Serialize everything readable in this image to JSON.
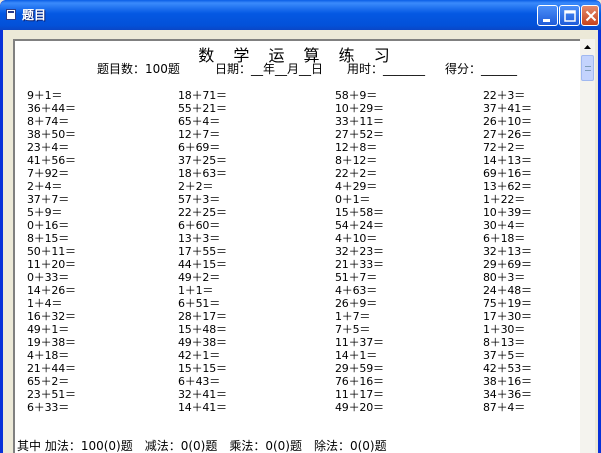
{
  "window": {
    "title": "题目"
  },
  "paper": {
    "heading": "数 学 运 算 练 习",
    "count_label": "题目数：100题",
    "date_label": "日期：__年__月__日",
    "time_label": "用时：_______",
    "score_label": "得分：______"
  },
  "problems": {
    "col1": [
      "9＋1＝",
      "36＋44＝",
      "8＋74＝",
      "38＋50＝",
      "23＋4＝",
      "41＋56＝",
      "7＋92＝",
      "2＋4＝",
      "37＋7＝",
      "5＋9＝",
      "0＋16＝",
      "8＋15＝",
      "50＋11＝",
      "11＋20＝",
      "0＋33＝",
      "14＋26＝",
      "1＋4＝",
      "16＋32＝",
      "49＋1＝",
      "19＋38＝",
      "4＋18＝",
      "21＋44＝",
      "65＋2＝",
      "23＋51＝",
      "6＋33＝"
    ],
    "col2": [
      "18＋71＝",
      "55＋21＝",
      "65＋4＝",
      "12＋7＝",
      "6＋69＝",
      "37＋25＝",
      "18＋63＝",
      "2＋2＝",
      "57＋3＝",
      "22＋25＝",
      "6＋60＝",
      "13＋3＝",
      "17＋55＝",
      "44＋15＝",
      "49＋2＝",
      "1＋1＝",
      "6＋51＝",
      "28＋17＝",
      "15＋48＝",
      "49＋38＝",
      "42＋1＝",
      "15＋15＝",
      "6＋43＝",
      "32＋41＝",
      "14＋41＝"
    ],
    "col3": [
      "58＋9＝",
      "10＋29＝",
      "33＋11＝",
      "27＋52＝",
      "12＋8＝",
      "8＋12＝",
      "22＋2＝",
      "4＋29＝",
      "0＋1＝",
      "15＋58＝",
      "54＋24＝",
      "4＋10＝",
      "32＋23＝",
      "21＋33＝",
      "51＋7＝",
      "4＋63＝",
      "26＋9＝",
      "1＋7＝",
      "7＋5＝",
      "11＋37＝",
      "14＋1＝",
      "29＋59＝",
      "76＋16＝",
      "11＋17＝",
      "49＋20＝"
    ],
    "col4": [
      "22＋3＝",
      "37＋41＝",
      "26＋10＝",
      "27＋26＝",
      "72＋2＝",
      "14＋13＝",
      "69＋16＝",
      "13＋62＝",
      "1＋22＝",
      "10＋39＝",
      "30＋4＝",
      "6＋18＝",
      "32＋13＝",
      "29＋69＝",
      "80＋3＝",
      "24＋48＝",
      "75＋19＝",
      "17＋30＝",
      "1＋30＝",
      "8＋13＝",
      "37＋5＝",
      "42＋53＝",
      "38＋16＝",
      "34＋36＝",
      "87＋4＝"
    ]
  },
  "summary": "其中 加法：100(0)题　减法：0(0)题　乘法：0(0)题　除法：0(0)题"
}
